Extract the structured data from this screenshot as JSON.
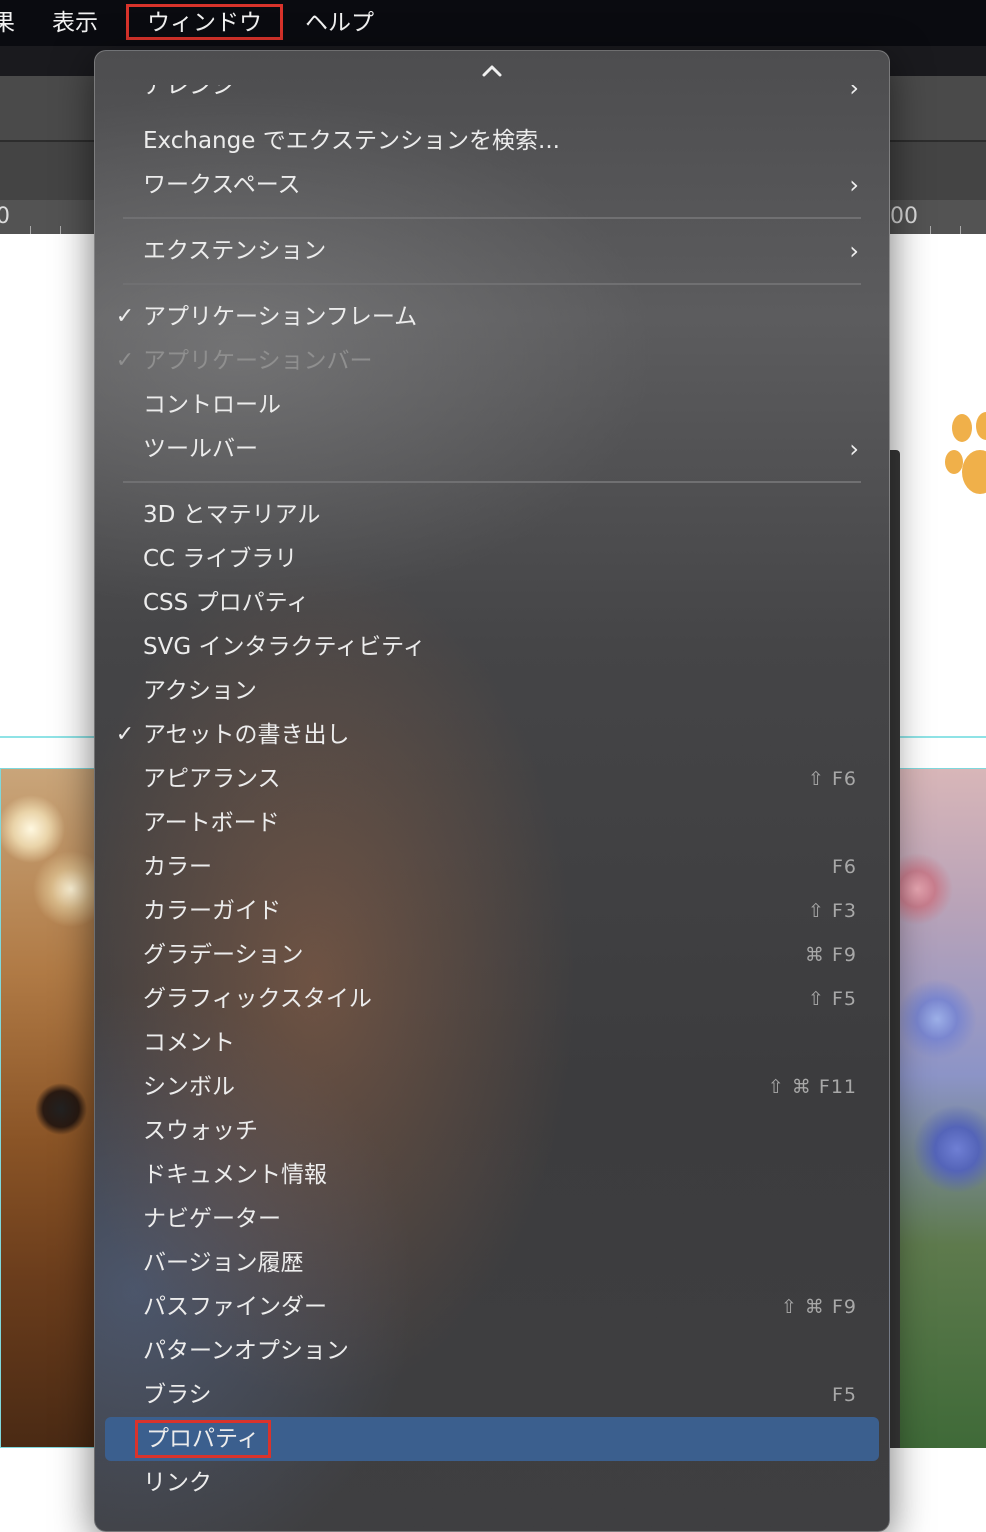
{
  "menubar": {
    "fragment": "果",
    "view": "表示",
    "window": "ウィンドウ",
    "help": "ヘルプ"
  },
  "ruler": {
    "left_number": "0",
    "right_number": "00"
  },
  "menu": {
    "scroll_up_icon": "chevron-up-icon",
    "cut_item": {
      "label": "アレンジ",
      "has_submenu": true
    },
    "items": [
      {
        "label": "Exchange でエクステンションを検索...",
        "checked": false,
        "enabled": true
      },
      {
        "label": "ワークスペース",
        "has_submenu": true
      },
      {
        "label": "エクステンション",
        "has_submenu": true
      },
      {
        "label": "アプリケーションフレーム",
        "checked": true,
        "enabled": true
      },
      {
        "label": "アプリケーションバー",
        "checked": true,
        "enabled": false
      },
      {
        "label": "コントロール"
      },
      {
        "label": "ツールバー",
        "has_submenu": true
      },
      {
        "label": "3D とマテリアル"
      },
      {
        "label": "CC ライブラリ"
      },
      {
        "label": "CSS プロパティ"
      },
      {
        "label": "SVG インタラクティビティ"
      },
      {
        "label": "アクション"
      },
      {
        "label": "アセットの書き出し",
        "checked": true
      },
      {
        "label": "アピアランス",
        "shortcut": "⇧ F6"
      },
      {
        "label": "アートボード"
      },
      {
        "label": "カラー",
        "shortcut": "F6"
      },
      {
        "label": "カラーガイド",
        "shortcut": "⇧ F3"
      },
      {
        "label": "グラデーション",
        "shortcut": "⌘ F9"
      },
      {
        "label": "グラフィックスタイル",
        "shortcut": "⇧ F5"
      },
      {
        "label": "コメント"
      },
      {
        "label": "シンボル",
        "shortcut": "⇧ ⌘ F11"
      },
      {
        "label": "スウォッチ"
      },
      {
        "label": "ドキュメント情報"
      },
      {
        "label": "ナビゲーター"
      },
      {
        "label": "バージョン履歴"
      },
      {
        "label": "パスファインダー",
        "shortcut": "⇧ ⌘ F9"
      },
      {
        "label": "パターンオプション"
      },
      {
        "label": "ブラシ",
        "shortcut": "F5"
      },
      {
        "label": "プロパティ",
        "highlighted": true
      },
      {
        "label": "リンク"
      }
    ],
    "check_glyph": "✓",
    "submenu_glyph": "›"
  },
  "colors": {
    "highlight": "#3b5f8e",
    "annotation_box": "#d9332b",
    "menubar": "#0a0b10"
  }
}
